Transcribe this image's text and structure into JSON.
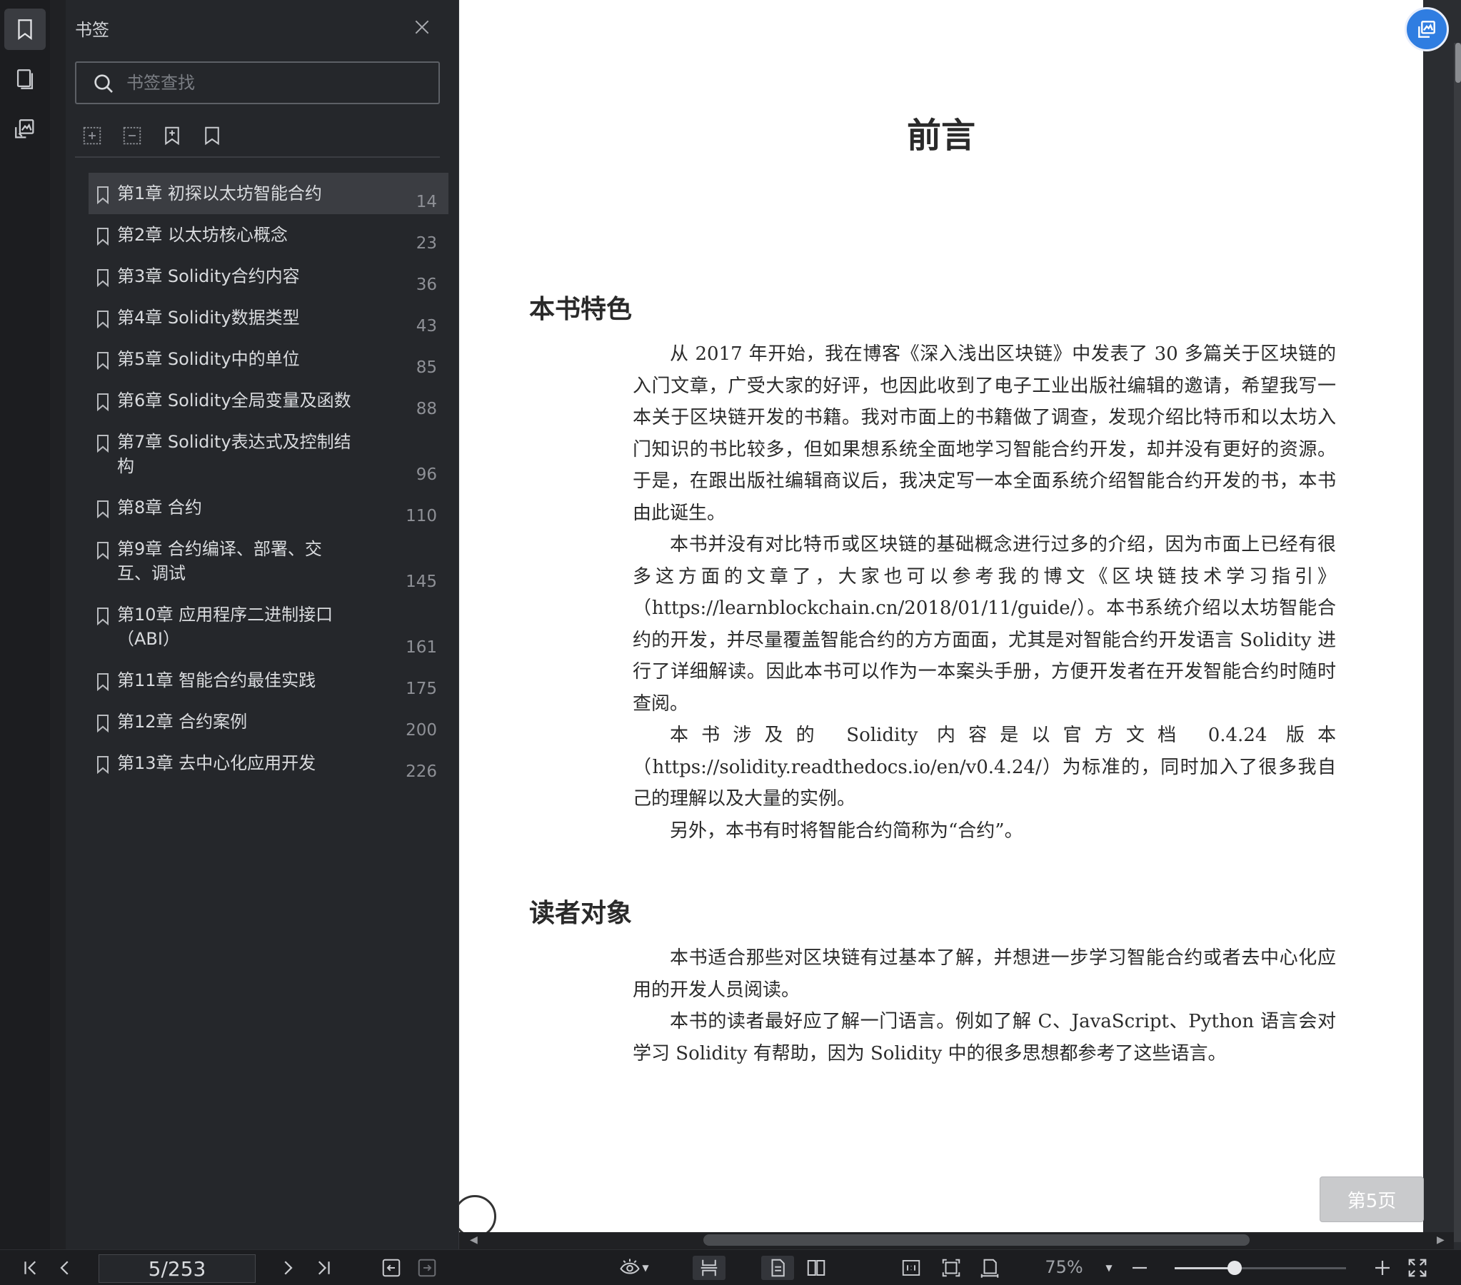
{
  "panel": {
    "title": "书签",
    "search_placeholder": "书签查找",
    "bookmarks": [
      {
        "label": "第1章 初探以太坊智能合约",
        "page": "14"
      },
      {
        "label": "第2章 以太坊核心概念",
        "page": "23"
      },
      {
        "label": "第3章 Solidity合约内容",
        "page": "36"
      },
      {
        "label": "第4章 Solidity数据类型",
        "page": "43"
      },
      {
        "label": "第5章 Solidity中的单位",
        "page": "85"
      },
      {
        "label": "第6章 Solidity全局变量及函数",
        "page": "88"
      },
      {
        "label": "第7章 Solidity表达式及控制结构",
        "page": "96"
      },
      {
        "label": "第8章 合约",
        "page": "110"
      },
      {
        "label": "第9章 合约编译、部署、交互、调试",
        "page": "145"
      },
      {
        "label": "第10章 应用程序二进制接口（ABI）",
        "page": "161"
      },
      {
        "label": "第11章 智能合约最佳实践",
        "page": "175"
      },
      {
        "label": "第12章 合约案例",
        "page": "200"
      },
      {
        "label": "第13章 去中心化应用开发",
        "page": "226"
      }
    ]
  },
  "document": {
    "heading": "前言",
    "section1": {
      "title": "本书特色",
      "paragraphs": [
        "从 2017 年开始，我在博客《深入浅出区块链》中发表了 30 多篇关于区块链的入门文章，广受大家的好评，也因此收到了电子工业出版社编辑的邀请，希望我写一本关于区块链开发的书籍。我对市面上的书籍做了调查，发现介绍比特币和以太坊入门知识的书比较多，但如果想系统全面地学习智能合约开发，却并没有更好的资源。于是，在跟出版社编辑商议后，我决定写一本全面系统介绍智能合约开发的书，本书由此诞生。",
        "本书并没有对比特币或区块链的基础概念进行过多的介绍，因为市面上已经有很多这方面的文章了，大家也可以参考我的博文《区块链技术学习指引》（https://learnblockchain.cn/2018/01/11/guide/）。本书系统介绍以太坊智能合约的开发，并尽量覆盖智能合约的方方面面，尤其是对智能合约开发语言 Solidity 进行了详细解读。因此本书可以作为一本案头手册，方便开发者在开发智能合约时随时查阅。",
        "本书涉及的 Solidity 内容是以官方文档 0.4.24 版本（https://solidity.readthedocs.io/en/v0.4.24/）为标准的，同时加入了很多我自己的理解以及大量的实例。",
        "另外，本书有时将智能合约简称为“合约”。"
      ]
    },
    "section2": {
      "title": "读者对象",
      "paragraphs": [
        "本书适合那些对区块链有过基本了解，并想进一步学习智能合约或者去中心化应用的开发人员阅读。",
        "本书的读者最好应了解一门语言。例如了解 C、JavaScript、Python 语言会对学习 Solidity 有帮助，因为 Solidity 中的很多思想都参考了这些语言。"
      ]
    },
    "page_badge": "第5页"
  },
  "toolbar": {
    "page_indicator": "5/253",
    "zoom": "75%",
    "zoom_fraction": 0.35
  },
  "colors": {
    "accent": "#2f7de1",
    "panel_bg": "#25272b",
    "selected_bg": "#3b3d42"
  }
}
